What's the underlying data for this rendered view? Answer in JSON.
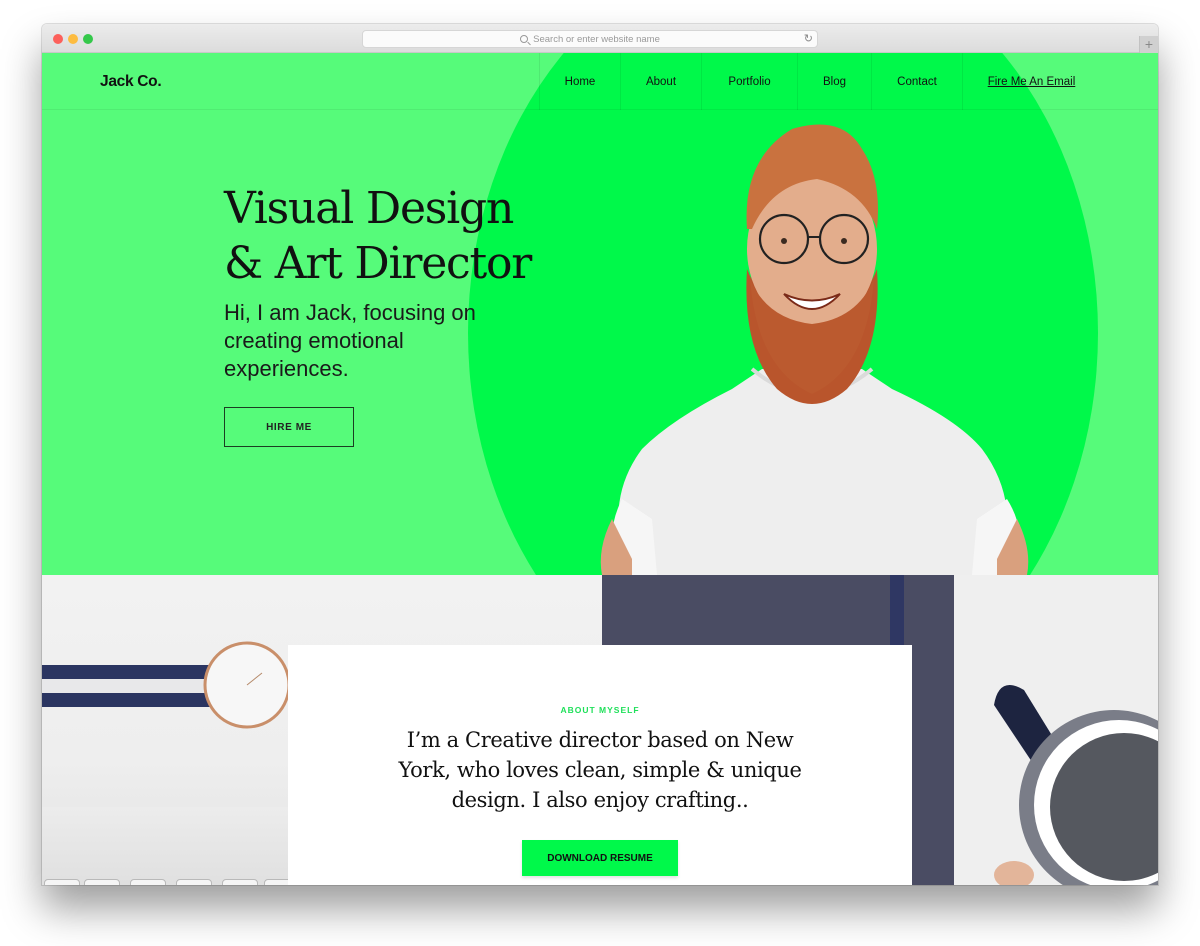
{
  "browser": {
    "address_placeholder": "Search or enter website name",
    "icons": {
      "search": "search-icon",
      "reload": "reload-icon",
      "new_tab": "plus-icon"
    },
    "new_tab_label": "+",
    "reload_glyph": "↻"
  },
  "site": {
    "logo": "Jack Co.",
    "nav": [
      {
        "label": "Home"
      },
      {
        "label": "About"
      },
      {
        "label": "Portfolio"
      },
      {
        "label": "Blog"
      },
      {
        "label": "Contact"
      },
      {
        "label": "Fire Me An Email"
      }
    ]
  },
  "hero": {
    "headline_line1": "Visual Design",
    "headline_line2": "& Art Director",
    "subline": "Hi, I am Jack, focusing on creating emotional experiences.",
    "cta": "HIRE ME",
    "image_description": "smiling bearded man with round glasses in white t-shirt"
  },
  "about": {
    "label": "ABOUT MYSELF",
    "text": "I’m a Creative director based on New York, who loves clean, simple & unique design. I also enjoy crafting..",
    "cta": "DOWNLOAD RESUME",
    "background_image_description": "desk with wristwatch, keyboard, notebook and coffee mug"
  },
  "colors": {
    "hero_bg": "#56fb7a",
    "accent": "#00f94a",
    "label_green": "#1fe05a",
    "text": "#111111"
  }
}
